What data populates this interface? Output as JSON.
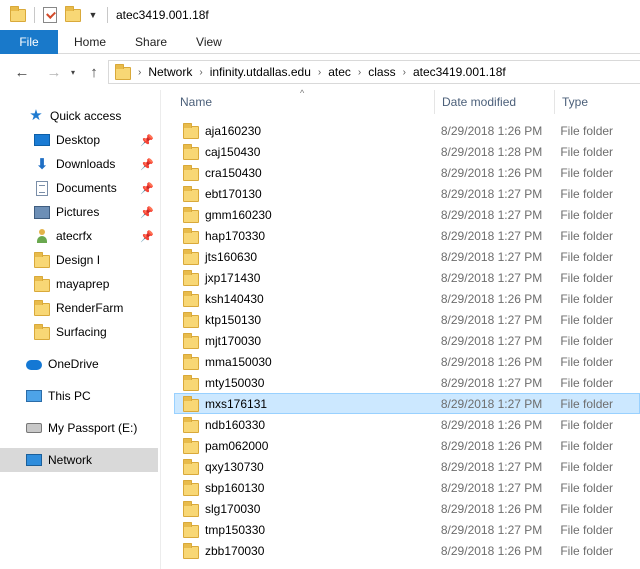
{
  "window": {
    "title": "atec3419.001.18f"
  },
  "ribbon": {
    "tabs": [
      "File",
      "Home",
      "Share",
      "View"
    ]
  },
  "address": {
    "crumbs": [
      "Network",
      "infinity.utdallas.edu",
      "atec",
      "class",
      "atec3419.001.18f"
    ]
  },
  "sidebar": {
    "items": [
      {
        "label": "Quick access",
        "icon": "quick-access-star-icon",
        "pinned": false
      },
      {
        "label": "Desktop",
        "icon": "desktop-icon",
        "pinned": true
      },
      {
        "label": "Downloads",
        "icon": "downloads-arrow-icon",
        "pinned": true
      },
      {
        "label": "Documents",
        "icon": "documents-icon",
        "pinned": true
      },
      {
        "label": "Pictures",
        "icon": "pictures-icon",
        "pinned": true
      },
      {
        "label": "atecrfx",
        "icon": "user-folder-icon",
        "pinned": true
      },
      {
        "label": "Design I",
        "icon": "folder-icon",
        "pinned": false
      },
      {
        "label": "mayaprep",
        "icon": "folder-icon",
        "pinned": false
      },
      {
        "label": "RenderFarm",
        "icon": "folder-icon",
        "pinned": false
      },
      {
        "label": "Surfacing",
        "icon": "folder-icon",
        "pinned": false
      },
      {
        "label": "OneDrive",
        "icon": "onedrive-cloud-icon",
        "pinned": false
      },
      {
        "label": "This PC",
        "icon": "this-pc-icon",
        "pinned": false
      },
      {
        "label": "My Passport (E:)",
        "icon": "drive-icon",
        "pinned": false
      },
      {
        "label": "Network",
        "icon": "network-icon",
        "pinned": false,
        "selected": true
      }
    ]
  },
  "columns": {
    "name": "Name",
    "date": "Date modified",
    "type": "Type"
  },
  "files": [
    {
      "name": "aja160230",
      "date": "8/29/2018 1:26 PM",
      "type": "File folder"
    },
    {
      "name": "caj150430",
      "date": "8/29/2018 1:28 PM",
      "type": "File folder"
    },
    {
      "name": "cra150430",
      "date": "8/29/2018 1:26 PM",
      "type": "File folder"
    },
    {
      "name": "ebt170130",
      "date": "8/29/2018 1:27 PM",
      "type": "File folder"
    },
    {
      "name": "gmm160230",
      "date": "8/29/2018 1:27 PM",
      "type": "File folder"
    },
    {
      "name": "hap170330",
      "date": "8/29/2018 1:27 PM",
      "type": "File folder"
    },
    {
      "name": "jts160630",
      "date": "8/29/2018 1:27 PM",
      "type": "File folder"
    },
    {
      "name": "jxp171430",
      "date": "8/29/2018 1:27 PM",
      "type": "File folder"
    },
    {
      "name": "ksh140430",
      "date": "8/29/2018 1:26 PM",
      "type": "File folder"
    },
    {
      "name": "ktp150130",
      "date": "8/29/2018 1:27 PM",
      "type": "File folder"
    },
    {
      "name": "mjt170030",
      "date": "8/29/2018 1:27 PM",
      "type": "File folder"
    },
    {
      "name": "mma150030",
      "date": "8/29/2018 1:26 PM",
      "type": "File folder"
    },
    {
      "name": "mty150030",
      "date": "8/29/2018 1:27 PM",
      "type": "File folder"
    },
    {
      "name": "mxs176131",
      "date": "8/29/2018 1:27 PM",
      "type": "File folder",
      "selected": true
    },
    {
      "name": "ndb160330",
      "date": "8/29/2018 1:26 PM",
      "type": "File folder"
    },
    {
      "name": "pam062000",
      "date": "8/29/2018 1:26 PM",
      "type": "File folder"
    },
    {
      "name": "qxy130730",
      "date": "8/29/2018 1:27 PM",
      "type": "File folder"
    },
    {
      "name": "sbp160130",
      "date": "8/29/2018 1:27 PM",
      "type": "File folder"
    },
    {
      "name": "slg170030",
      "date": "8/29/2018 1:26 PM",
      "type": "File folder"
    },
    {
      "name": "tmp150330",
      "date": "8/29/2018 1:27 PM",
      "type": "File folder"
    },
    {
      "name": "zbb170030",
      "date": "8/29/2018 1:26 PM",
      "type": "File folder"
    }
  ],
  "colors": {
    "accent": "#1979ca",
    "selection": "#cce8ff",
    "folder": "#f8d775"
  }
}
